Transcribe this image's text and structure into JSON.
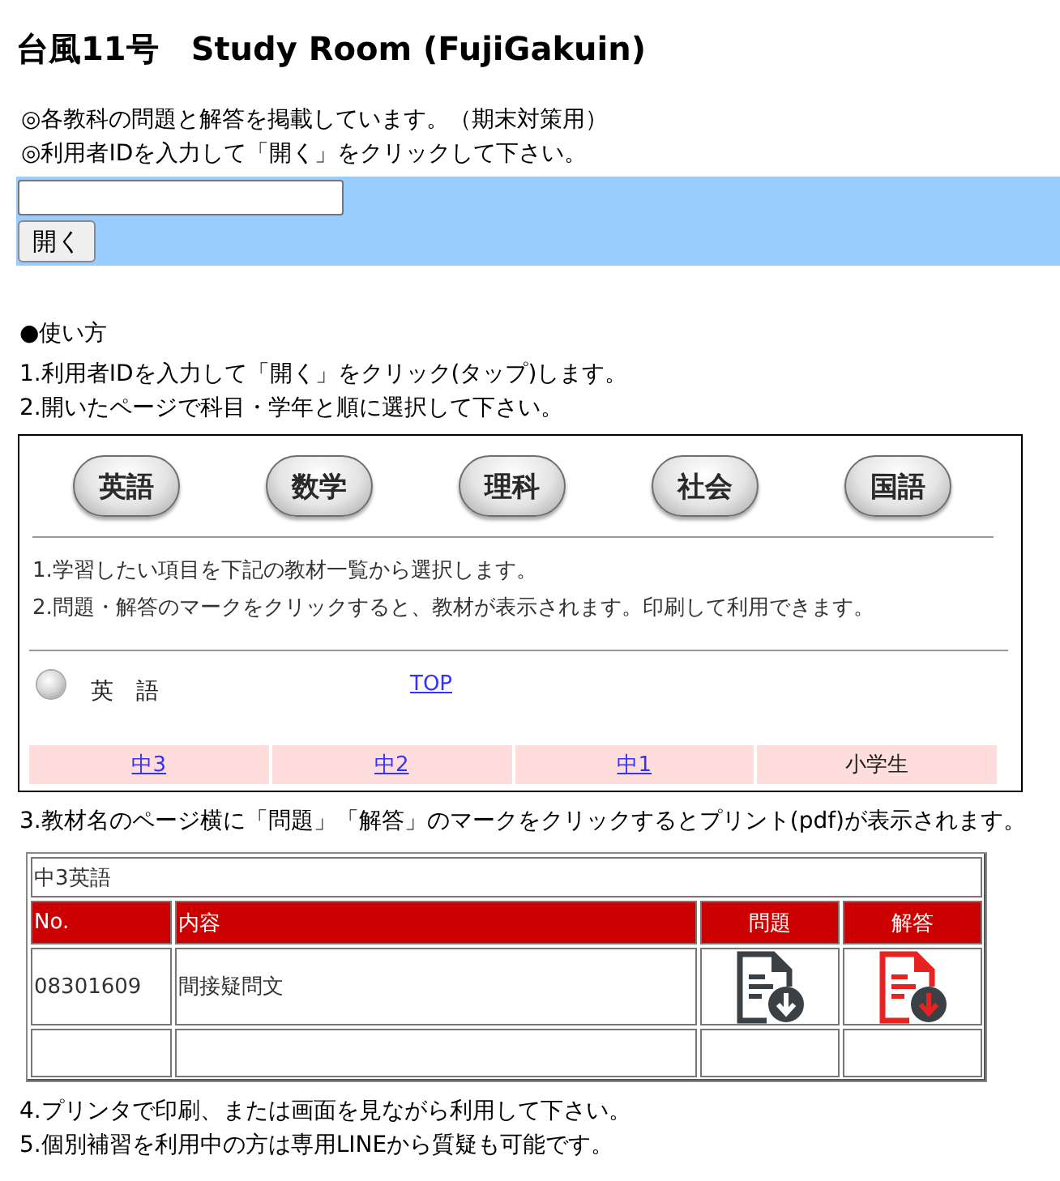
{
  "title": "台風11号　Study Room (FujiGakuin)",
  "notices": [
    "◎各教科の問題と解答を掲載しています。（期末対策用）",
    "◎利用者IDを入力して「開く」をクリックして下さい。"
  ],
  "login": {
    "button": "開く"
  },
  "usage": {
    "heading": "●使い方",
    "items": [
      {
        "kind": "step",
        "text": "1.利用者IDを入力して「開く」をクリック(タップ)します。"
      },
      {
        "kind": "step",
        "text": "2.開いたページで科目・学年と順に選択して下さい。"
      },
      {
        "kind": "subject_panel",
        "subjects": [
          "英語",
          "数学",
          "理科",
          "社会",
          "国語"
        ],
        "notes": [
          "1.学習したい項目を下記の教材一覧から選択します。",
          "2.問題・解答のマークをクリックすると、教材が表示されます。印刷して利用できます。"
        ],
        "subject": "英　語",
        "top_link": "TOP",
        "grades": [
          {
            "label": "中3",
            "kind": "link"
          },
          {
            "label": "中2",
            "kind": "link"
          },
          {
            "label": "中1",
            "kind": "link"
          },
          {
            "label": "小学生",
            "kind": "text"
          }
        ]
      },
      {
        "kind": "step",
        "text": "3.教材名のページ横に「問題」「解答」のマークをクリックするとプリント(pdf)が表示されます。"
      },
      {
        "kind": "material_table",
        "caption": "中3英語",
        "columns": [
          "No.",
          "内容",
          "問題",
          "解答"
        ],
        "rows": [
          {
            "number": "08301609",
            "content": "間接疑問文"
          }
        ]
      },
      {
        "kind": "step",
        "text": "4.プリンタで印刷、または画面を見ながら利用して下さい。"
      },
      {
        "kind": "step",
        "text": "5.個別補習を利用中の方は専用LINEから質疑も可能です。"
      }
    ]
  }
}
